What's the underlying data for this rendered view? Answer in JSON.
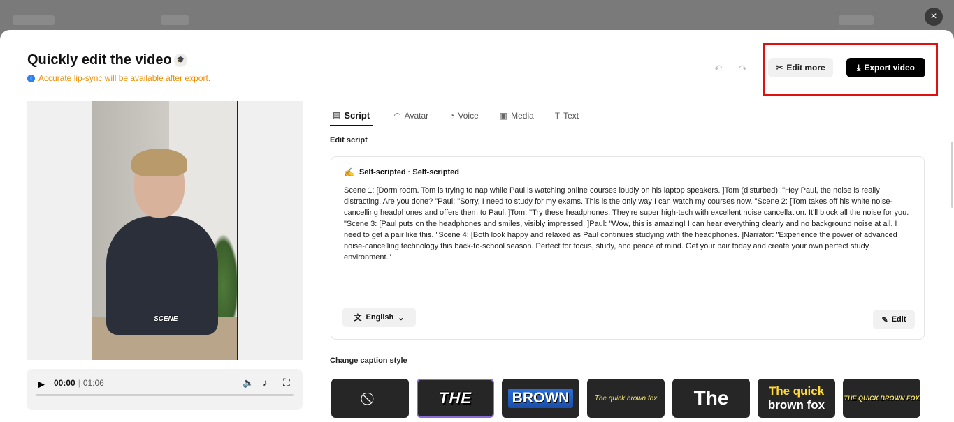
{
  "close_icon": "×",
  "header": {
    "title": "Quickly edit the video",
    "notice": "Accurate lip-sync will be available after export.",
    "undo_icon": "↶",
    "redo_icon": "↷",
    "edit_more_label": "Edit more",
    "export_label": "Export video"
  },
  "preview": {
    "caption_overlay": "SCENE"
  },
  "player": {
    "current_time": "00:00",
    "separator": "|",
    "duration": "01:06",
    "progress": 0
  },
  "tabs": [
    {
      "label": "Script",
      "icon": "script-icon",
      "active": true
    },
    {
      "label": "Avatar",
      "icon": "avatar-icon"
    },
    {
      "label": "Voice",
      "icon": "voice-icon"
    },
    {
      "label": "Media",
      "icon": "media-icon"
    },
    {
      "label": "Text",
      "icon": "text-icon"
    }
  ],
  "script": {
    "section_label": "Edit script",
    "source": "Self-scripted · Self-scripted",
    "text": "Scene 1: [Dorm room. Tom is trying to nap while Paul is watching online courses loudly on his laptop speakers. ]Tom (disturbed): \"Hey Paul, the noise is really distracting. Are you done? \"Paul: \"Sorry, I need to study for my exams. This is the only way I can watch my courses now. \"Scene 2: [Tom takes off his white noise-cancelling headphones and offers them to Paul. ]Tom: \"Try these headphones. They're super high-tech with excellent noise cancellation. It'll block all the noise for you. \"Scene 3: [Paul puts on the headphones and smiles, visibly impressed. ]Paul: \"Wow, this is amazing! I can hear everything clearly and no background noise at all. I need to get a pair like this. \"Scene 4: [Both look happy and relaxed as Paul continues studying with the headphones. ]Narrator: \"Experience the power of advanced noise-cancelling technology this back-to-school season. Perfect for focus, study, and peace of mind. Get your pair today and create your own perfect study environment.\"",
    "language": "English",
    "edit_label": "Edit"
  },
  "captions": {
    "label": "Change caption style",
    "styles": [
      {
        "text": "⃠",
        "kind": "none"
      },
      {
        "text": "THE",
        "kind": "the",
        "selected": true
      },
      {
        "text": "BROWN",
        "kind": "brown"
      },
      {
        "text": "The quick brown fox",
        "kind": "fox"
      },
      {
        "text": "The",
        "kind": "the2"
      },
      {
        "line1": "The quick",
        "line2": "brown fox",
        "kind": "quick"
      },
      {
        "text": "THE QUICK BROWN FOX",
        "kind": "upper"
      }
    ]
  }
}
